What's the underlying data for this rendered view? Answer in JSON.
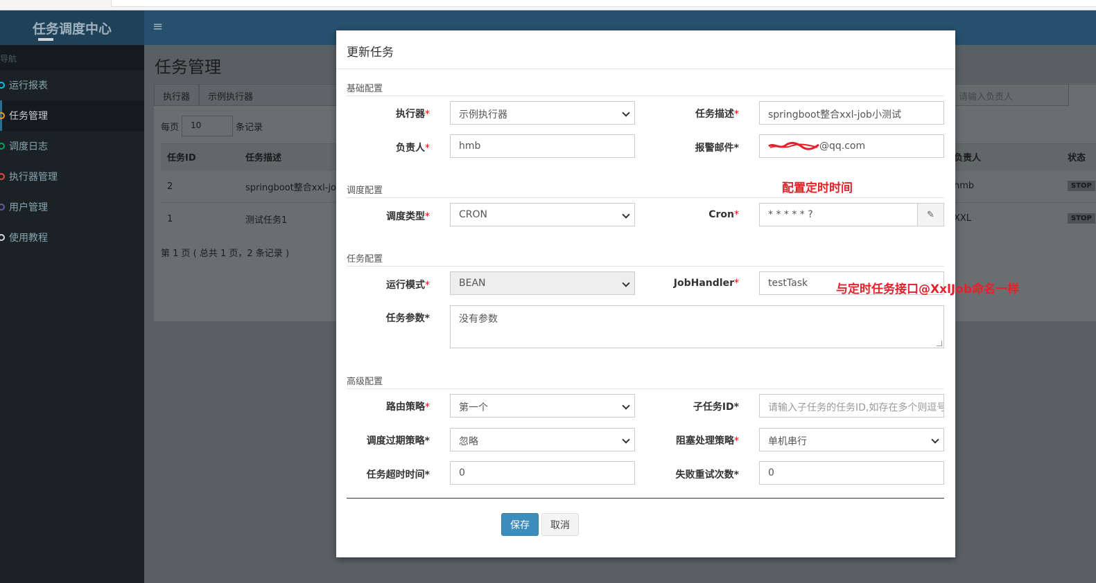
{
  "app": {
    "logo": "任务调度中心",
    "menu_icon": "≡"
  },
  "sidebar": {
    "header": "导航",
    "items": [
      {
        "label": "运行报表",
        "color": "#00c0ef"
      },
      {
        "label": "任务管理",
        "color": "#f39c12"
      },
      {
        "label": "调度日志",
        "color": "#00a65a"
      },
      {
        "label": "执行器管理",
        "color": "#dd4b39"
      },
      {
        "label": "用户管理",
        "color": "#605ca8"
      },
      {
        "label": "使用教程",
        "color": "#d2d6de"
      }
    ]
  },
  "main": {
    "title": "任务管理",
    "filter": {
      "executor_label": "执行器",
      "executor_value": "示例执行器",
      "owner_placeholder": "请输入负责人"
    },
    "per_page_prefix": "每页",
    "per_page_value": "10",
    "per_page_suffix": "条记录",
    "columns": [
      "任务ID",
      "任务描述",
      "负责人",
      "状态"
    ],
    "rows": [
      {
        "id": "2",
        "desc": "springboot整合xxl-job小测试",
        "owner": "hmb",
        "status": "STOP"
      },
      {
        "id": "1",
        "desc": "测试任务1",
        "owner": "XXL",
        "status": "STOP"
      }
    ],
    "pager": "第 1 页 ( 总共 1 页，2 条记录 )"
  },
  "modal": {
    "title": "更新任务",
    "sections": {
      "basic": "基础配置",
      "schedule": "调度配置",
      "task": "任务配置",
      "advanced": "高级配置"
    },
    "fields": {
      "executor": {
        "label": "执行器",
        "value": "示例执行器"
      },
      "job_desc": {
        "label": "任务描述",
        "value": "springboot整合xxl-job小测试"
      },
      "author": {
        "label": "负责人",
        "value": "hmb"
      },
      "alarm_email": {
        "label": "报警邮件",
        "value": "@qq.com"
      },
      "schedule_type": {
        "label": "调度类型",
        "value": "CRON"
      },
      "cron": {
        "label": "Cron",
        "value": "* * * * * ?"
      },
      "glue_type": {
        "label": "运行模式",
        "value": "BEAN"
      },
      "job_handler": {
        "label": "JobHandler",
        "value": "testTask"
      },
      "job_param": {
        "label": "任务参数",
        "value": "没有参数"
      },
      "route_strategy": {
        "label": "路由策略",
        "value": "第一个"
      },
      "child_job": {
        "label": "子任务ID",
        "placeholder": "请输入子任务的任务ID,如存在多个则逗号分隔"
      },
      "misfire": {
        "label": "调度过期策略",
        "value": "忽略"
      },
      "block_strategy": {
        "label": "阻塞处理策略",
        "value": "单机串行"
      },
      "timeout": {
        "label": "任务超时时间",
        "value": "0"
      },
      "fail_retry": {
        "label": "失败重试次数",
        "value": "0"
      }
    },
    "buttons": {
      "save": "保存",
      "cancel": "取消"
    }
  },
  "annotations": {
    "cron_note": "配置定时时间",
    "handler_note": "与定时任务接口@XxlJob命名一样"
  }
}
